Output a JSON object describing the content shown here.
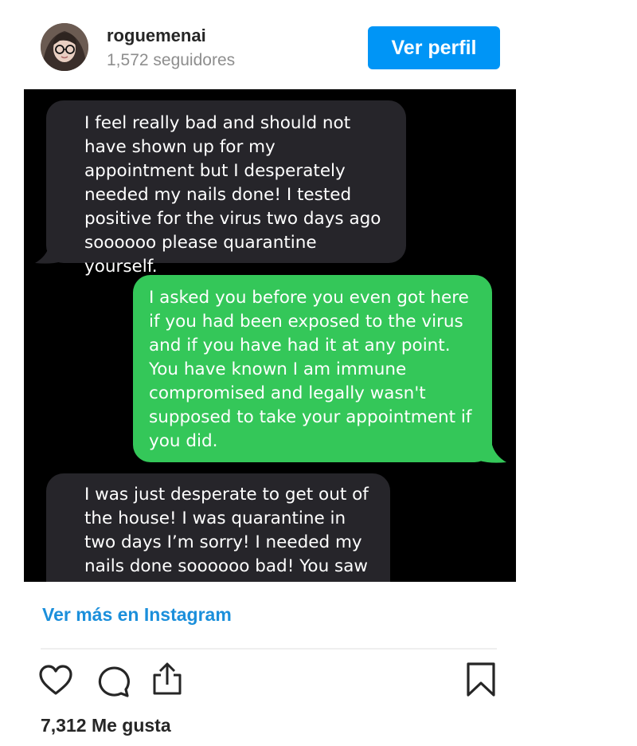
{
  "header": {
    "username": "roguemenai",
    "followers": "1,572 seguidores",
    "profile_button": "Ver perfil"
  },
  "messages": [
    {
      "sender": "other",
      "text": "I feel really bad and should not have shown up for my appointment but I desperately needed my nails done! I tested positive for the virus two days ago soooooo please quarantine yourself."
    },
    {
      "sender": "me",
      "text": "I asked you before you even got here if you had been exposed to the virus and if you have had it at any point. You have known I am immune compromised and legally wasn't supposed to take your appointment if you did."
    },
    {
      "sender": "other",
      "text": "I was just desperate to get out of the house! I was quarantine in two days I’m sorry! I needed my nails done soooooo bad! You saw how"
    }
  ],
  "footer": {
    "more_link": "Ver más en Instagram",
    "likes": "7,312 Me gusta"
  },
  "icons": [
    "heart-icon",
    "comment-icon",
    "share-icon",
    "bookmark-icon"
  ],
  "colors": {
    "accent": "#0095f6",
    "link": "#1b8fdb",
    "incoming_bubble": "#26252a",
    "outgoing_bubble": "#34c759",
    "chat_background": "#000000"
  }
}
